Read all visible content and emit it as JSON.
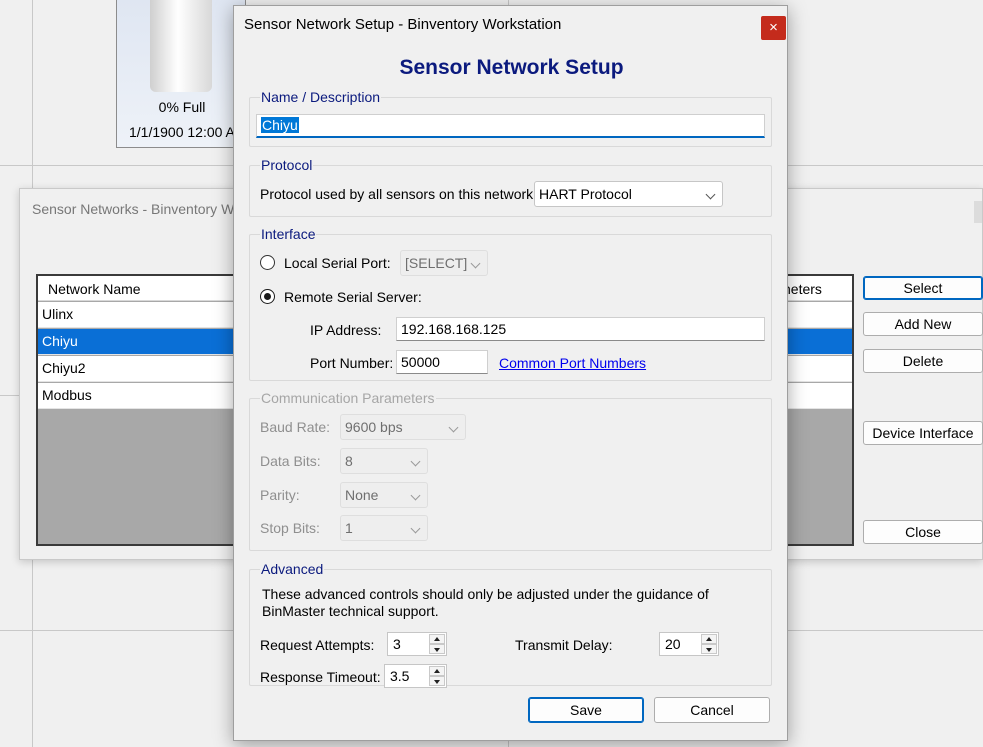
{
  "background": {
    "bin_tile": {
      "fill_text": "0% Full",
      "date_text": "1/1/1900 12:00 A"
    }
  },
  "networks_window": {
    "title": "Sensor Networks - Binventory W",
    "columns": [
      "Network Name",
      "neters"
    ],
    "rows": [
      {
        "name": "Ulinx",
        "selected": false
      },
      {
        "name": "Chiyu",
        "selected": true
      },
      {
        "name": "Chiyu2",
        "selected": false
      },
      {
        "name": "Modbus",
        "selected": false
      }
    ],
    "buttons": {
      "select": "Select",
      "add_new": "Add New",
      "delete": "Delete",
      "device_interface": "Device Interface",
      "close": "Close"
    }
  },
  "dialog": {
    "title": "Sensor Network Setup - Binventory Workstation",
    "close_glyph": "×",
    "heading": "Sensor Network Setup",
    "name_group": {
      "legend": "Name / Description",
      "value": "Chiyu"
    },
    "protocol_group": {
      "legend": "Protocol",
      "label": "Protocol used by all sensors on this network:",
      "selected": "HART Protocol"
    },
    "interface_group": {
      "legend": "Interface",
      "local_label": "Local Serial Port:",
      "local_selected": "[SELECT]",
      "remote_label": "Remote Serial Server:",
      "selected_mode": "remote",
      "ip_label": "IP Address:",
      "ip_value": "192.168.168.125",
      "port_label": "Port Number:",
      "port_value": "50000",
      "port_link": "Common Port Numbers"
    },
    "comm_group": {
      "legend": "Communication Parameters",
      "baud_label": "Baud Rate:",
      "baud_value": "9600 bps",
      "data_bits_label": "Data Bits:",
      "data_bits_value": "8",
      "parity_label": "Parity:",
      "parity_value": "None",
      "stop_bits_label": "Stop Bits:",
      "stop_bits_value": "1"
    },
    "advanced_group": {
      "legend": "Advanced",
      "note": "These advanced controls should only be adjusted under the guidance of BinMaster technical support.",
      "request_attempts_label": "Request Attempts:",
      "request_attempts_value": "3",
      "transmit_delay_label": "Transmit Delay:",
      "transmit_delay_value": "20",
      "response_timeout_label": "Response Timeout:",
      "response_timeout_value": "3.5"
    },
    "buttons": {
      "save": "Save",
      "cancel": "Cancel"
    }
  },
  "colors": {
    "heading": "#0b1a7e",
    "selection": "#0a6fd6",
    "close_button": "#c42b1c",
    "link": "#0000ee"
  }
}
